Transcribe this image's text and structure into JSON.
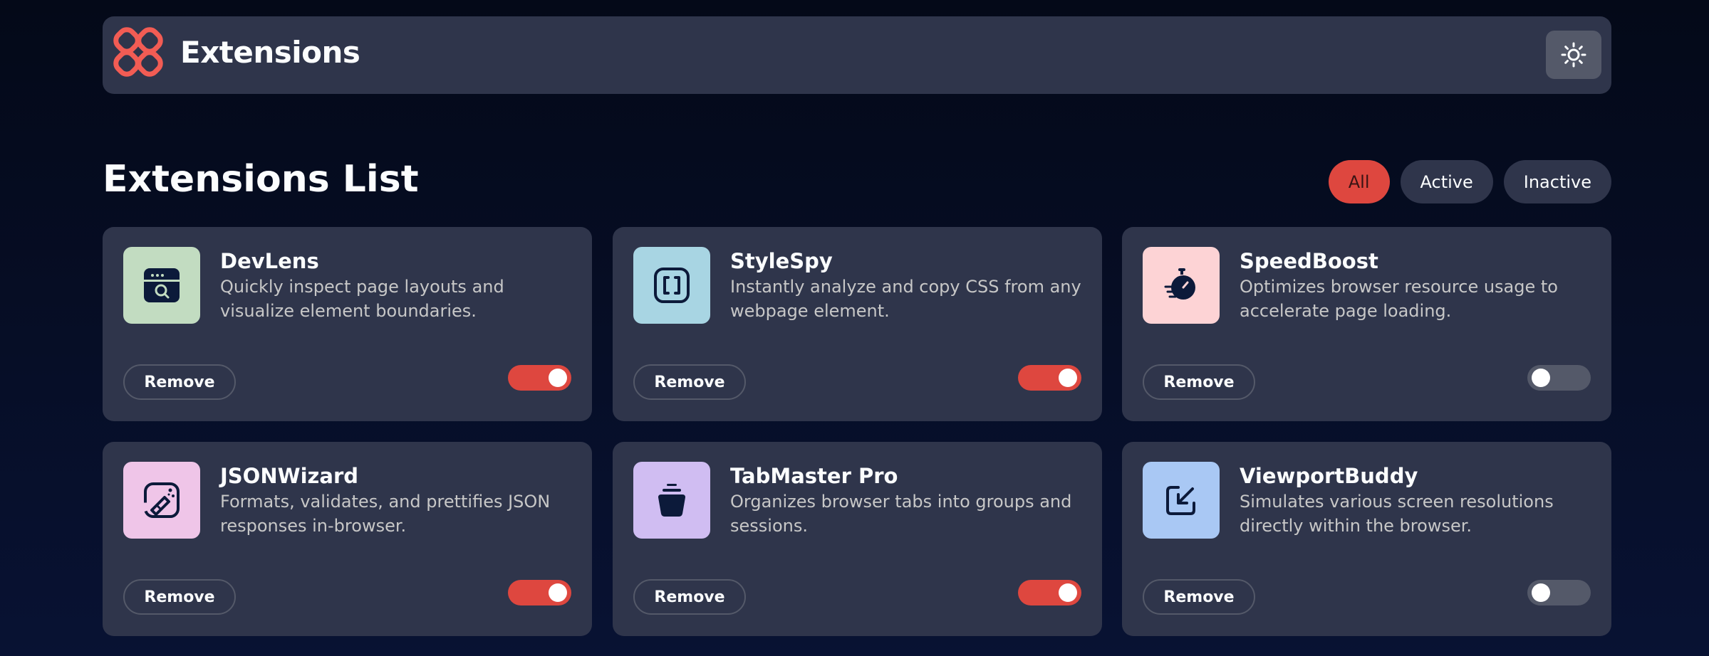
{
  "header": {
    "title": "Extensions",
    "logo_icon": "logo-icon",
    "theme_icon": "sun-icon",
    "logo_color": "#f25c54"
  },
  "list": {
    "title": "Extensions List",
    "filters": [
      {
        "label": "All",
        "active": true
      },
      {
        "label": "Active",
        "active": false
      },
      {
        "label": "Inactive",
        "active": false
      }
    ]
  },
  "extensions": [
    {
      "name": "DevLens",
      "description": "Quickly inspect page layouts and visualize element boundaries.",
      "remove_label": "Remove",
      "enabled": true,
      "icon": "browser-search-icon",
      "icon_bg": "#c2dcc1"
    },
    {
      "name": "StyleSpy",
      "description": "Instantly analyze and copy CSS from any webpage element.",
      "remove_label": "Remove",
      "enabled": true,
      "icon": "brackets-icon",
      "icon_bg": "#a8d5e3"
    },
    {
      "name": "SpeedBoost",
      "description": "Optimizes browser resource usage to accelerate page loading.",
      "remove_label": "Remove",
      "enabled": false,
      "icon": "stopwatch-icon",
      "icon_bg": "#fdd3d5"
    },
    {
      "name": "JSONWizard",
      "description": "Formats, validates, and prettifies JSON responses in-browser.",
      "remove_label": "Remove",
      "enabled": true,
      "icon": "wand-icon",
      "icon_bg": "#efc5e8"
    },
    {
      "name": "TabMaster Pro",
      "description": "Organizes browser tabs into groups and sessions.",
      "remove_label": "Remove",
      "enabled": true,
      "icon": "stack-icon",
      "icon_bg": "#d0bdf2"
    },
    {
      "name": "ViewportBuddy",
      "description": "Simulates various screen resolutions directly within the browser.",
      "remove_label": "Remove",
      "enabled": false,
      "icon": "resize-icon",
      "icon_bg": "#a9c8f4"
    }
  ]
}
